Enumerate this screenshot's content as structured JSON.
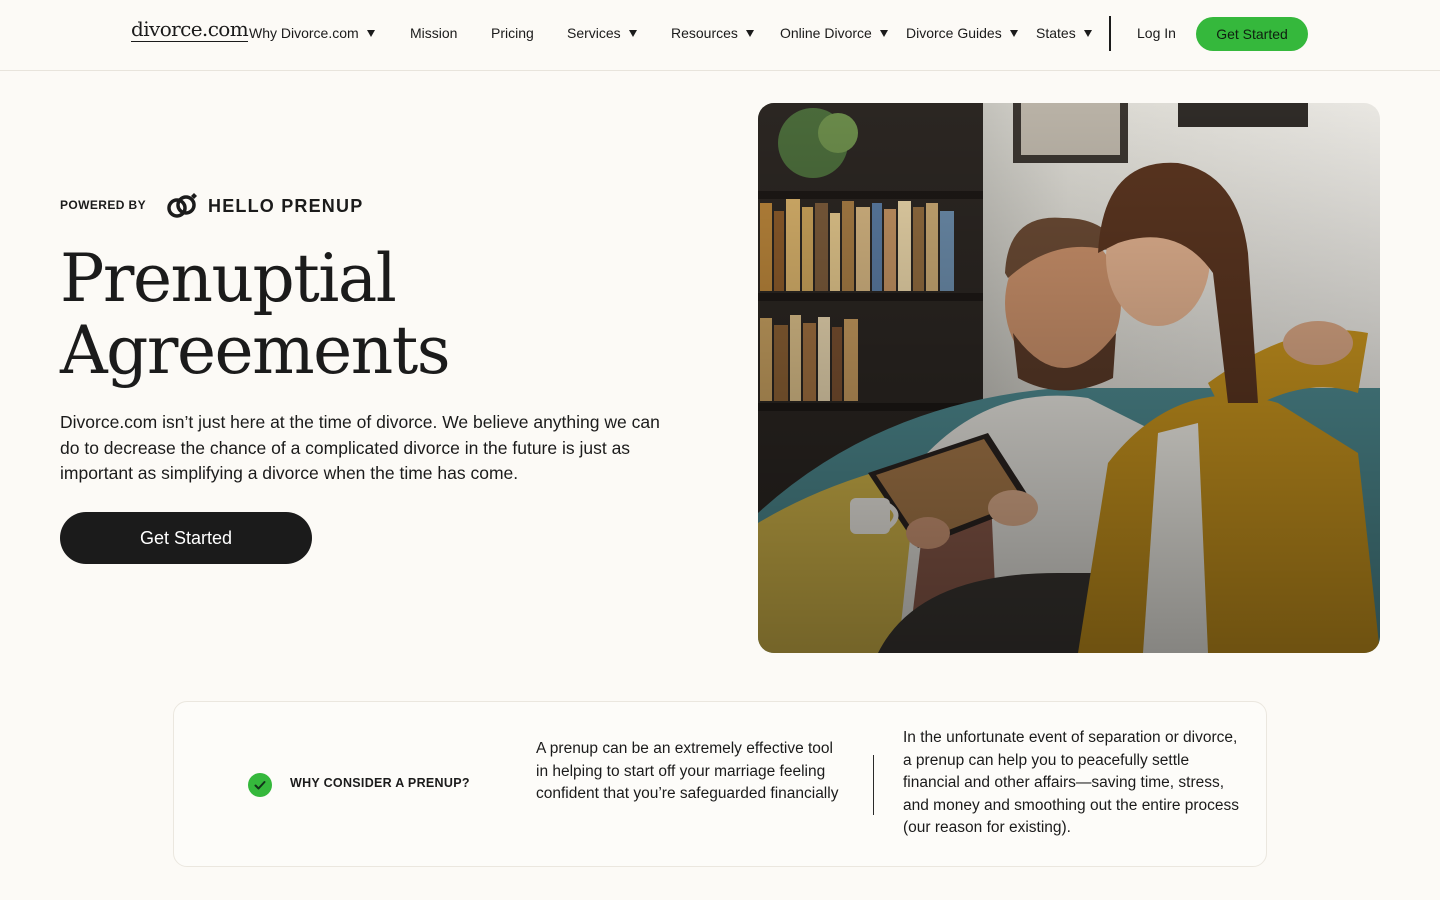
{
  "nav": {
    "logo": "divorce.com",
    "items": [
      {
        "label": "Why Divorce.com",
        "dropdown": true
      },
      {
        "label": "Mission",
        "dropdown": false
      },
      {
        "label": "Pricing",
        "dropdown": false
      },
      {
        "label": "Services",
        "dropdown": true
      },
      {
        "label": "Resources",
        "dropdown": true
      },
      {
        "label": "Online Divorce",
        "dropdown": true
      },
      {
        "label": "Divorce Guides",
        "dropdown": true
      },
      {
        "label": "States",
        "dropdown": true
      }
    ],
    "login": "Log In",
    "cta": "Get Started"
  },
  "hero": {
    "powered_by": "POWERED BY",
    "partner": "HELLO PRENUP",
    "title_line1": "Prenuptial",
    "title_line2": "Agreements",
    "description": "Divorce.com isn’t just here at the time of divorce. We believe anything we can do to decrease the chance of a complicated divorce in the future is just as important as simplifying a divorce when the time has come.",
    "cta": "Get Started"
  },
  "card": {
    "heading": "WHY CONSIDER A PRENUP?",
    "text1": "A prenup can be an extremely effective tool in helping to start off your marriage feeling confident that you’re safeguarded financially",
    "text2": "In the unfortunate event of separation or divorce, a prenup can help you to peacefully settle financial and other affairs—saving time, stress, and money and smoothing out the entire process (our reason for existing)."
  },
  "colors": {
    "background": "#fcfaf6",
    "accent_green": "#35b83c",
    "dark": "#1b1b1b"
  },
  "icons": {
    "dropdown": "chevron-down-icon",
    "partner_logo": "rings-icon",
    "check": "check-icon"
  }
}
